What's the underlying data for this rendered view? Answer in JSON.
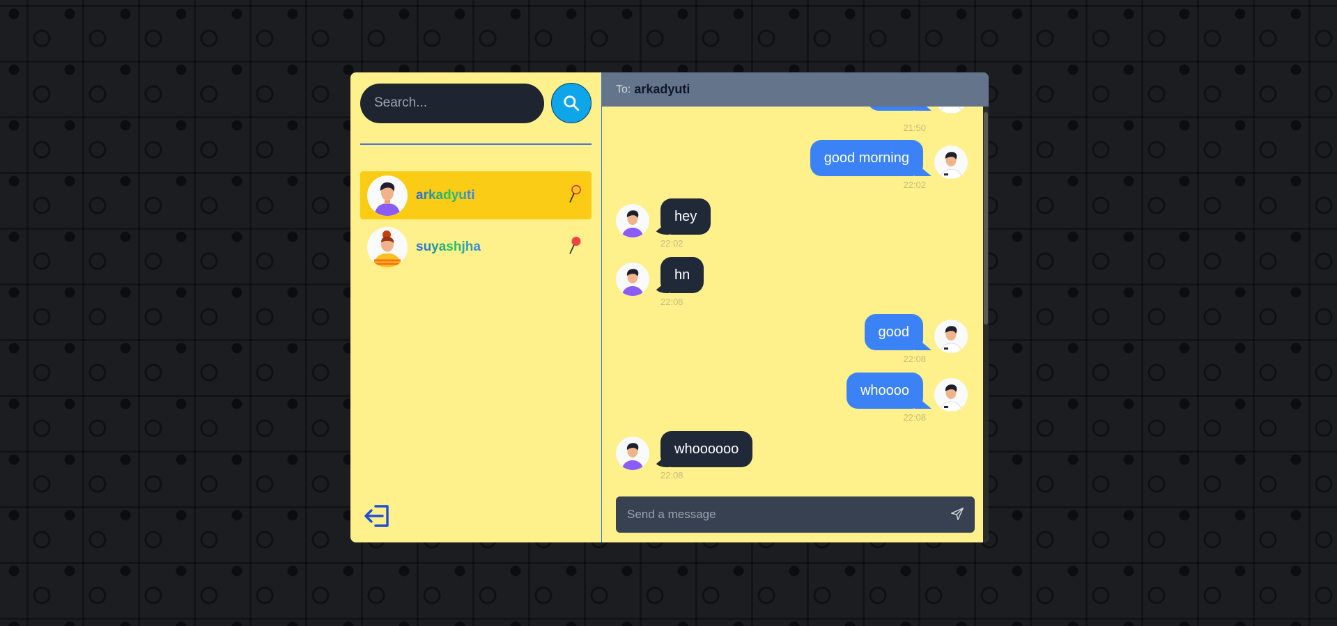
{
  "colors": {
    "panel": "#fef08a",
    "selected": "#facc15",
    "outgoing_bubble": "#3b82f6",
    "incoming_bubble": "#1f2937",
    "header": "#64748b",
    "search_button": "#0ea5e9"
  },
  "sidebar": {
    "search": {
      "placeholder": "Search..."
    },
    "conversations": [
      {
        "name": "arkadyuti",
        "selected": true,
        "status_icon": "pin-outline-icon"
      },
      {
        "name": "suyashjha",
        "selected": false,
        "status_icon": "pin-red-icon"
      }
    ],
    "logout_icon": "logout-icon"
  },
  "chat": {
    "header": {
      "to_label": "To:",
      "to_name": "arkadyuti"
    },
    "messages": [
      {
        "from": "me",
        "text": "",
        "time": "21:50"
      },
      {
        "from": "me",
        "text": "good morning",
        "time": "22:02"
      },
      {
        "from": "them",
        "text": "hey",
        "time": "22:02"
      },
      {
        "from": "them",
        "text": "hn",
        "time": "22:08"
      },
      {
        "from": "me",
        "text": "good",
        "time": "22:08"
      },
      {
        "from": "me",
        "text": "whoooo",
        "time": "22:08"
      },
      {
        "from": "them",
        "text": "whoooooo",
        "time": "22:08"
      }
    ],
    "composer": {
      "placeholder": "Send a message"
    }
  }
}
